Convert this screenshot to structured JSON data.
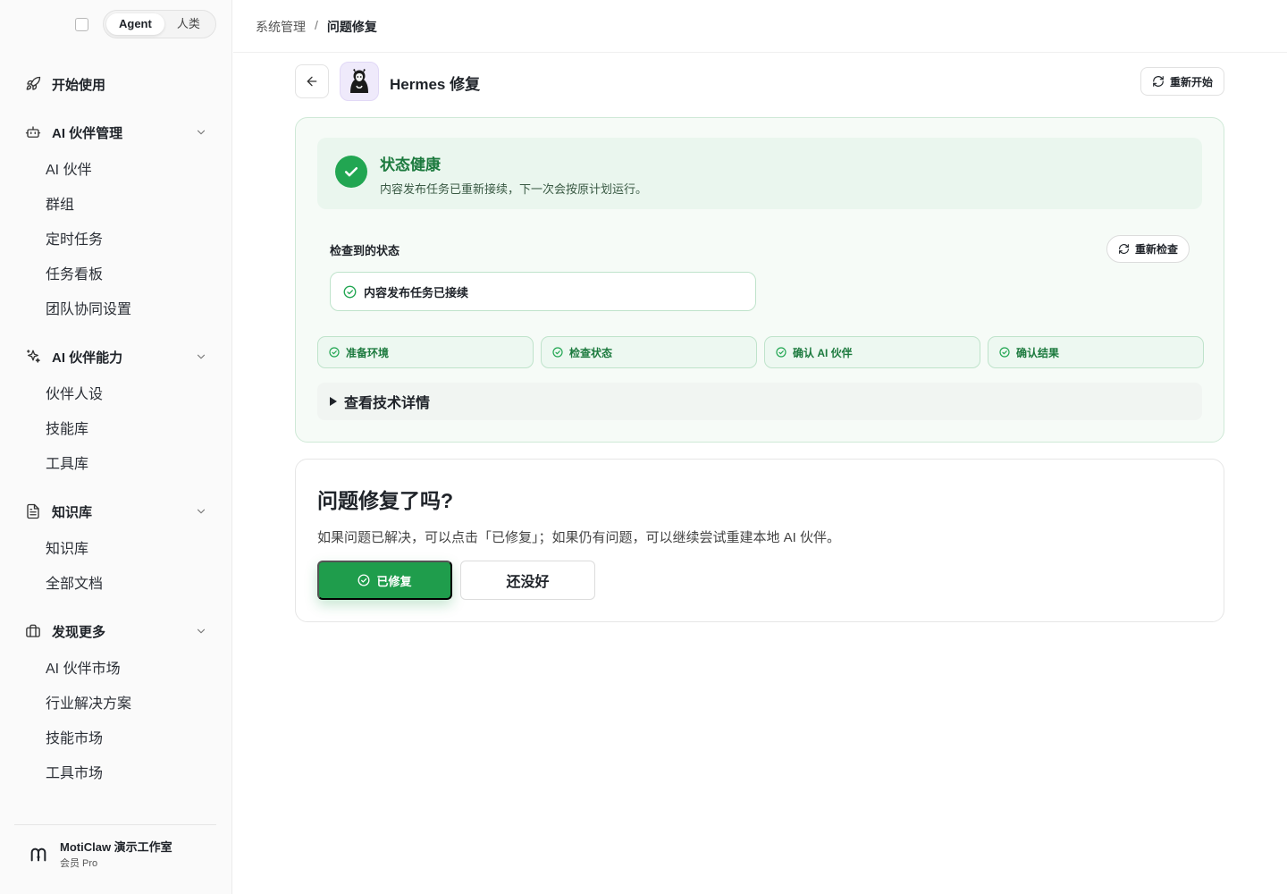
{
  "sidebar": {
    "mode": {
      "options": [
        "Agent",
        "人类"
      ],
      "selected": "Agent"
    },
    "groups": [
      {
        "label": "开始使用",
        "icon": "rocket-icon",
        "items": []
      },
      {
        "label": "AI 伙伴管理",
        "icon": "bot-icon",
        "items": [
          "AI 伙伴",
          "群组",
          "定时任务",
          "任务看板",
          "团队协同设置"
        ]
      },
      {
        "label": "AI 伙伴能力",
        "icon": "sparkles-icon",
        "items": [
          "伙伴人设",
          "技能库",
          "工具库"
        ]
      },
      {
        "label": "知识库",
        "icon": "document-icon",
        "items": [
          "知识库",
          "全部文档"
        ]
      },
      {
        "label": "发现更多",
        "icon": "briefcase-icon",
        "items": [
          "AI 伙伴市场",
          "行业解决方案",
          "技能市场",
          "工具市场"
        ]
      }
    ],
    "footer": {
      "workspace": "MotiClaw 演示工作室",
      "plan": "会员 Pro"
    }
  },
  "breadcrumb": {
    "parent": "系统管理",
    "separator": "/",
    "current": "问题修复"
  },
  "page": {
    "title": "Hermes 修复",
    "restart_label": "重新开始"
  },
  "status": {
    "title": "状态健康",
    "description": "内容发布任务已重新接续，下一次会按原计划运行。",
    "checked_label": "检查到的状态",
    "recheck_label": "重新检查",
    "checked_item": "内容发布任务已接续",
    "steps": [
      "准备环境",
      "检查状态",
      "确认 AI 伙伴",
      "确认结果"
    ],
    "details_label": "查看技术详情"
  },
  "fix": {
    "title": "问题修复了吗?",
    "description": "如果问题已解决，可以点击「已修复」；如果仍有问题，可以继续尝试重建本地 AI 伙伴。",
    "fixed_label": "已修复",
    "not_yet_label": "还没好"
  },
  "colors": {
    "accent_green": "#1f9d4c",
    "success_text": "#1c7a3e",
    "sidebar_bg": "#fafafa"
  }
}
